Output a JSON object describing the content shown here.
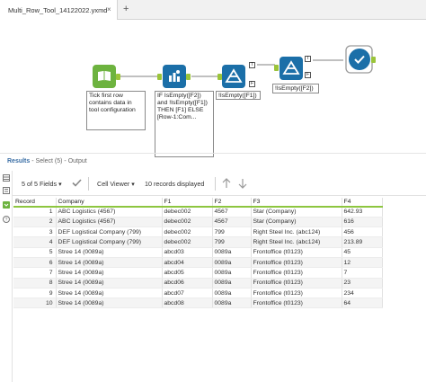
{
  "tabs": {
    "active_label": "Multi_Row_Tool_14122022.yxmd",
    "close_glyph": "×",
    "add_glyph": "+"
  },
  "canvas": {
    "anno_input": "Tick first row contains data in tool configuration",
    "anno_formula": "IF IsEmpty([F2]) and !IsEmpty([F1]) THEN [F1] ELSE [Row-1:Com...",
    "anno_filter1": "!IsEmpty([F1])",
    "anno_filter2": "!IsEmpty([F2])",
    "anchor_t": "T",
    "anchor_f": "F",
    "colors": {
      "input": "#6db33f",
      "formula": "#1b6fa8",
      "filter": "#1b6fa8",
      "browse": "#1b6fa8",
      "connector": "#9a9a9a",
      "anchor": "#9bc43a"
    }
  },
  "results": {
    "title": "Results",
    "subtitle": "- Select (5) - Output",
    "fields_label": "5 of 5 Fields",
    "viewer_label": "Cell Viewer",
    "records_label": "10 records displayed"
  },
  "table": {
    "headers": [
      "Record",
      "Company",
      "F1",
      "F2",
      "F3",
      "F4"
    ],
    "rows": [
      [
        "1",
        "ABC Logistics (4567)",
        "debec002",
        "4567",
        "Star (Company)",
        "642.93"
      ],
      [
        "2",
        "ABC Logistics (4567)",
        "debec002",
        "4567",
        "Star (Company)",
        "616"
      ],
      [
        "3",
        "DEF Logistical Company (799)",
        "debec002",
        "799",
        "Right Steel Inc. (abc124)",
        "456"
      ],
      [
        "4",
        "DEF Logistical Company (799)",
        "debec002",
        "799",
        "Right Steel Inc. (abc124)",
        "213.89"
      ],
      [
        "5",
        "Stree 14 (0089a)",
        "abcd03",
        "0089a",
        "Frontoffice (t0123)",
        "45"
      ],
      [
        "6",
        "Stree 14 (0089a)",
        "abcd04",
        "0089a",
        "Frontoffice (t0123)",
        "12"
      ],
      [
        "7",
        "Stree 14 (0089a)",
        "abcd05",
        "0089a",
        "Frontoffice (t0123)",
        "7"
      ],
      [
        "8",
        "Stree 14 (0089a)",
        "abcd06",
        "0089a",
        "Frontoffice (t0123)",
        "23"
      ],
      [
        "9",
        "Stree 14 (0089a)",
        "abcd07",
        "0089a",
        "Frontoffice (t0123)",
        "234"
      ],
      [
        "10",
        "Stree 14 (0089a)",
        "abcd08",
        "0089a",
        "Frontoffice (t0123)",
        "64"
      ]
    ]
  },
  "icons": [
    "book-icon",
    "formula-icon",
    "filter-icon",
    "browse-icon",
    "checkmark-icon",
    "gear-icon",
    "up-arrow-icon",
    "down-arrow-icon",
    "dropdown-icon"
  ]
}
